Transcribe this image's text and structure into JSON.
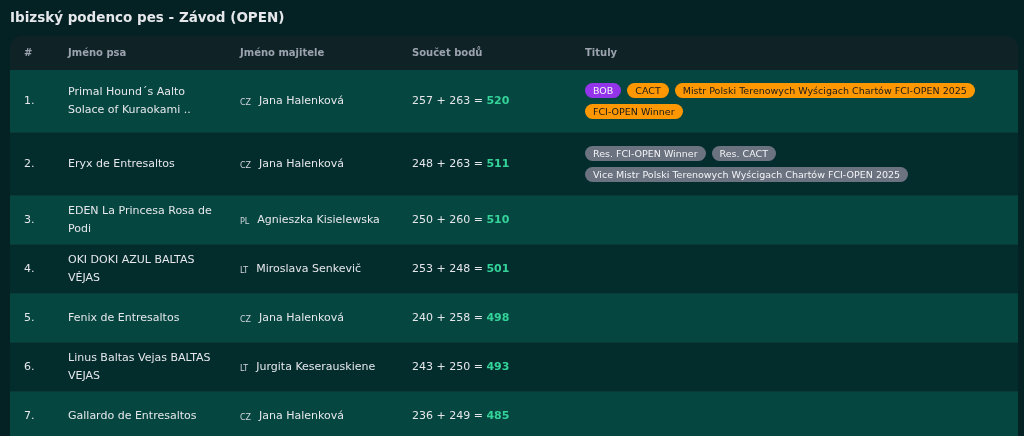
{
  "heading": "Ibizský podenco pes - Závod (OPEN)",
  "table": {
    "columns": [
      "#",
      "Jméno psa",
      "Jméno majitele",
      "Součet bodů",
      "Tituly"
    ],
    "rows": [
      {
        "rank": "1.",
        "dog": "Primal Hound´s Aalto Solace of Kuraokami ..",
        "country": "CZ",
        "owner": "Jana Halenková",
        "sum": "257 + 263 =",
        "total": "520",
        "titles": [
          {
            "label": "BOB",
            "color": "#9333ea"
          },
          {
            "label": "CACT",
            "color": "#ff9800"
          },
          {
            "label": "Mistr Polski Terenowych Wyścigach Chartów FCI-OPEN 2025",
            "color": "#ff9800"
          },
          {
            "label": "FCI-OPEN Winner",
            "color": "#ff9800"
          }
        ]
      },
      {
        "rank": "2.",
        "dog": "Eryx de Entresaltos",
        "country": "CZ",
        "owner": "Jana Halenková",
        "sum": "248 + 263 =",
        "total": "511",
        "titles": [
          {
            "label": "Res. FCI-OPEN Winner",
            "color": "#6b7280"
          },
          {
            "label": "Res. CACT",
            "color": "#6b7280"
          },
          {
            "label": "Vice Mistr Polski Terenowych Wyścigach Chartów FCI-OPEN 2025",
            "color": "#6b7280"
          }
        ]
      },
      {
        "rank": "3.",
        "dog": "EDEN La Princesa Rosa de Podi",
        "country": "PL",
        "owner": "Agnieszka Kisielewska",
        "sum": "250 + 260 =",
        "total": "510",
        "titles": []
      },
      {
        "rank": "4.",
        "dog": "OKI DOKI AZUL BALTAS VĖJAS",
        "country": "LT",
        "owner": "Miroslava Senkevič",
        "sum": "253 + 248 =",
        "total": "501",
        "titles": []
      },
      {
        "rank": "5.",
        "dog": "Fenix de Entresaltos",
        "country": "CZ",
        "owner": "Jana Halenková",
        "sum": "240 + 258 =",
        "total": "498",
        "titles": []
      },
      {
        "rank": "6.",
        "dog": "Linus Baltas Vejas BALTAS VEJAS",
        "country": "LT",
        "owner": "Jurgita Keserauskiene",
        "sum": "243 + 250 =",
        "total": "493",
        "titles": []
      },
      {
        "rank": "7.",
        "dog": "Gallardo de Entresaltos",
        "country": "CZ",
        "owner": "Jana Halenková",
        "sum": "236 + 249 =",
        "total": "485",
        "titles": []
      }
    ]
  }
}
